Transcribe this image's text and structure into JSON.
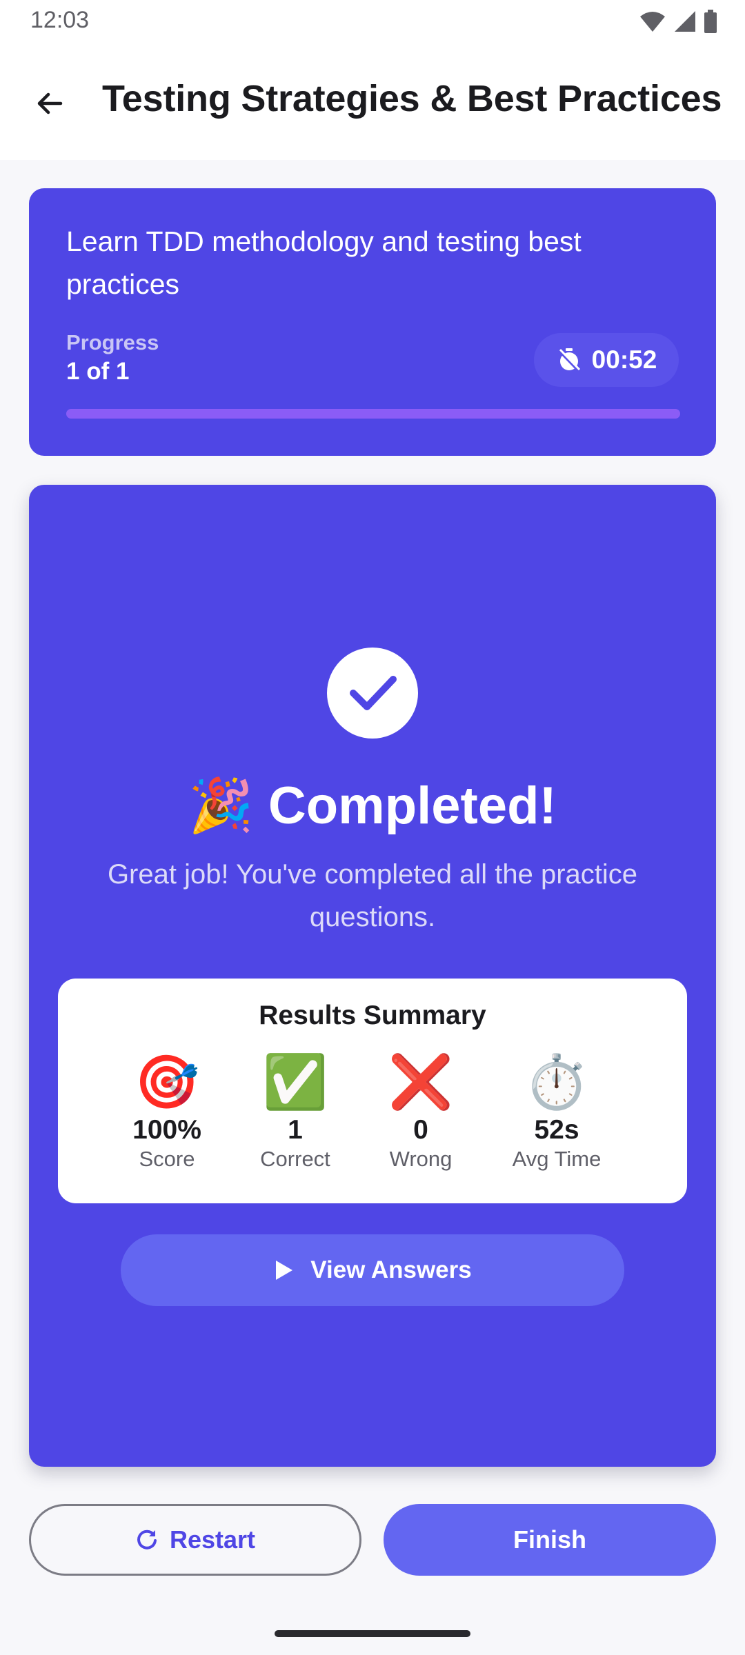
{
  "status_bar": {
    "time": "12:03"
  },
  "header": {
    "title": "Testing Strategies & Best Practices",
    "back_icon": "arrow-left-icon"
  },
  "info_card": {
    "description": "Learn TDD methodology and testing best practices",
    "progress_label": "Progress",
    "progress_value": "1 of 1",
    "progress_fraction": 1.0,
    "timer": "00:52",
    "timer_icon": "timer-off-icon"
  },
  "result": {
    "title": "🎉 Completed!",
    "subtitle": "Great job! You've completed all the practice questions.",
    "summary_title": "Results Summary",
    "stats": [
      {
        "emoji": "🎯",
        "value": "100%",
        "label": "Score"
      },
      {
        "emoji": "✅",
        "value": "1",
        "label": "Correct"
      },
      {
        "emoji": "❌",
        "value": "0",
        "label": "Wrong"
      },
      {
        "emoji": "⏱️",
        "value": "52s",
        "label": "Avg Time"
      }
    ],
    "view_answers_label": "View Answers"
  },
  "footer": {
    "restart_label": "Restart",
    "finish_label": "Finish"
  },
  "colors": {
    "primary": "#4f46e5",
    "accent": "#6366f1",
    "progress_fill": "#8b5cf6"
  }
}
